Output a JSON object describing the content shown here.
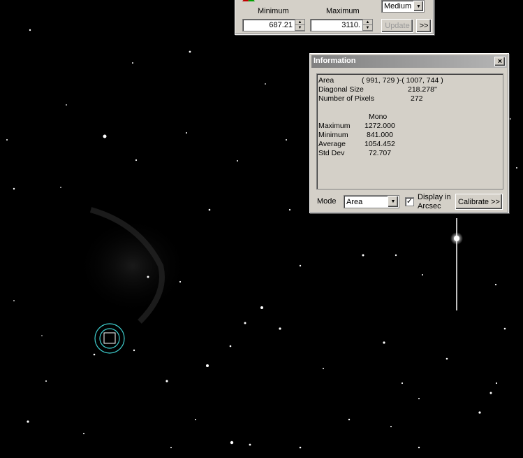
{
  "stretch_panel": {
    "minimum_label": "Minimum",
    "maximum_label": "Maximum",
    "minimum_value": "687.21",
    "maximum_value": "3110.",
    "quality_value": "Medium",
    "update_label": "Update",
    "more_label": ">>"
  },
  "info_window": {
    "title": "Information",
    "close_glyph": "×",
    "rows_top": [
      {
        "label": "Area",
        "value": "( 991, 729 )-( 1007, 744 )"
      },
      {
        "label": "Diagonal Size",
        "value": "218.278''"
      },
      {
        "label": "Number of Pixels",
        "value": "272"
      }
    ],
    "column_header": "Mono",
    "stats": [
      {
        "label": "Maximum",
        "value": "1272.000"
      },
      {
        "label": "Minimum",
        "value": "841.000"
      },
      {
        "label": "Average",
        "value": "1054.452"
      },
      {
        "label": "Std Dev",
        "value": "72.707"
      }
    ],
    "mode_label": "Mode",
    "mode_value": "Area",
    "arcsec_line1": "Display in",
    "arcsec_line2": "Arcsec",
    "arcsec_checked": true,
    "calibrate_label": "Calibrate >>"
  },
  "colors": {
    "panel_gray": "#d4d0c8",
    "title_gray": "#808080",
    "marker_cyan": "#3fd0d0"
  }
}
